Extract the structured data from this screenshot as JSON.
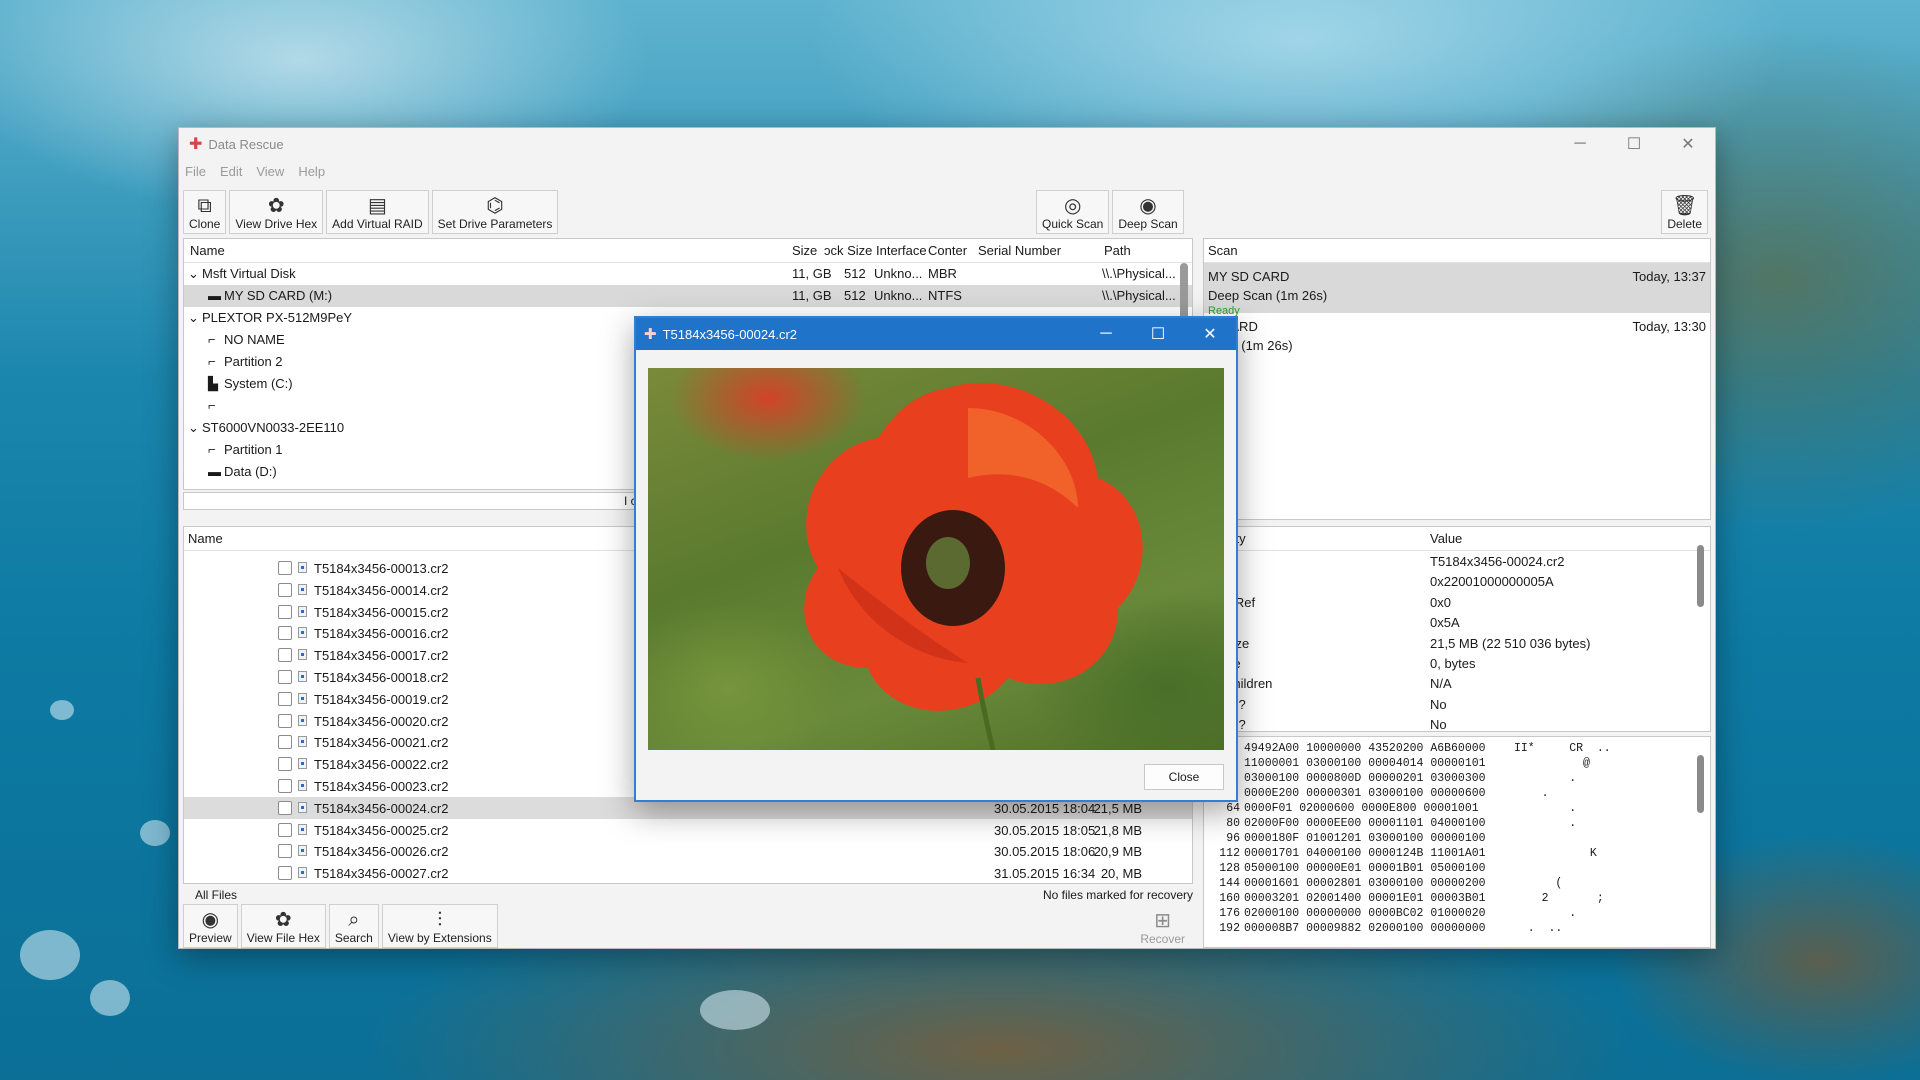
{
  "app": {
    "title": "Data Rescue",
    "menu": [
      "File",
      "Edit",
      "View",
      "Help"
    ],
    "window_controls": {
      "minimize": "─",
      "maximize": "☐",
      "close": "✕"
    }
  },
  "toolbar": {
    "clone": "Clone",
    "view_drive_hex": "View Drive Hex",
    "add_virtual_raid": "Add Virtual RAID",
    "set_drive_parameters": "Set Drive Parameters",
    "quick_scan": "Quick Scan",
    "deep_scan": "Deep Scan",
    "delete": "Delete"
  },
  "drives": {
    "columns": {
      "name": "Name",
      "size": "Size",
      "block_size": "ɔck Size",
      "interface": "Interface",
      "content": "Conter",
      "serial": "Serial Number",
      "path": "Path"
    },
    "rows": [
      {
        "name": "Msft Virtual Disk",
        "size": "",
        "block": "",
        "iface": "",
        "content": "",
        "path": ""
      },
      {
        "name": "MY SD CARD (M:)",
        "size": "11, GB",
        "block": "512",
        "iface": "Unkno...",
        "content": "NTFS",
        "path": "\\\\.\\Physical..."
      },
      {
        "name": "PLEXTOR PX-512M9PeY",
        "size": "",
        "block": "",
        "iface": "",
        "content": "",
        "path": ""
      },
      {
        "name": "NO NAME",
        "size": "",
        "block": "",
        "iface": "",
        "content": "",
        "path": ""
      },
      {
        "name": "Partition 2",
        "size": "",
        "block": "",
        "iface": "",
        "content": "",
        "path": ""
      },
      {
        "name": "System (C:)",
        "size": "",
        "block": "",
        "iface": "",
        "content": "",
        "path": ""
      },
      {
        "name": "",
        "size": "",
        "block": "",
        "iface": "",
        "content": "",
        "path": ""
      },
      {
        "name": "ST6000VN0033-2EE110",
        "size": "",
        "block": "",
        "iface": "",
        "content": "",
        "path": ""
      },
      {
        "name": "Partition 1",
        "size": "",
        "block": "",
        "iface": "",
        "content": "",
        "path": ""
      },
      {
        "name": "Data (D:)",
        "size": "",
        "block": "",
        "iface": "",
        "content": "",
        "path": ""
      }
    ],
    "msft": {
      "size": "11, GB",
      "block": "512",
      "iface": "Unkno...",
      "content": "MBR",
      "path": "\\\\.\\Physical..."
    },
    "scroll_label": "I c"
  },
  "scans": {
    "header": "Scan",
    "items": [
      {
        "name": "MY SD CARD",
        "time": "Today, 13:37",
        "detail": "Deep Scan (1m 26s)",
        "status": "Ready"
      },
      {
        "name": "D CARD",
        "time": "Today, 13:30",
        "detail": "Scan (1m 26s)",
        "status": "y"
      }
    ]
  },
  "files": {
    "header": "Name",
    "rows": [
      {
        "name": "T5184x3456-00013.cr2",
        "date": "",
        "size": ""
      },
      {
        "name": "T5184x3456-00014.cr2",
        "date": "",
        "size": ""
      },
      {
        "name": "T5184x3456-00015.cr2",
        "date": "",
        "size": ""
      },
      {
        "name": "T5184x3456-00016.cr2",
        "date": "",
        "size": ""
      },
      {
        "name": "T5184x3456-00017.cr2",
        "date": "",
        "size": ""
      },
      {
        "name": "T5184x3456-00018.cr2",
        "date": "",
        "size": ""
      },
      {
        "name": "T5184x3456-00019.cr2",
        "date": "",
        "size": ""
      },
      {
        "name": "T5184x3456-00020.cr2",
        "date": "",
        "size": ""
      },
      {
        "name": "T5184x3456-00021.cr2",
        "date": "",
        "size": ""
      },
      {
        "name": "T5184x3456-00022.cr2",
        "date": "",
        "size": ""
      },
      {
        "name": "T5184x3456-00023.cr2",
        "date": "",
        "size": ""
      },
      {
        "name": "T5184x3456-00024.cr2",
        "date": "30.05.2015 18:04",
        "size": "21,5 MB"
      },
      {
        "name": "T5184x3456-00025.cr2",
        "date": "30.05.2015 18:05",
        "size": "21,8 MB"
      },
      {
        "name": "T5184x3456-00026.cr2",
        "date": "30.05.2015 18:06",
        "size": "20,9 MB"
      },
      {
        "name": "T5184x3456-00027.cr2",
        "date": "31.05.2015 16:34",
        "size": "20, MB"
      }
    ],
    "filter_label": "All Files",
    "recovery_status": "No files marked for recovery"
  },
  "bottom_toolbar": {
    "preview": "Preview",
    "view_file_hex": "View File Hex",
    "search": "Search",
    "view_by_extensions": "View by Extensions",
    "recover": "Recover"
  },
  "properties": {
    "col_property": "erty",
    "col_value": "Value",
    "rows": [
      {
        "k": "e",
        "v": "T5184x3456-00024.cr2"
      },
      {
        "k": "f",
        "v": "0x22001000000005A"
      },
      {
        "k": "e Ref",
        "v": "0x0"
      },
      {
        "k": "",
        "v": "0x5A"
      },
      {
        "k": "Size",
        "v": "21,5 MB (22 510 036 bytes)"
      },
      {
        "k": "ize",
        "v": "0, bytes"
      },
      {
        "k": "Children",
        "v": "N/A"
      },
      {
        "k": "en?",
        "v": "No"
      },
      {
        "k": "ed?",
        "v": "No"
      }
    ]
  },
  "hex": {
    "rows": [
      {
        "off": "",
        "hex": "49492A00 10000000 43520200 A6B60000",
        "ascii": "II*     CR  .."
      },
      {
        "off": "",
        "hex": "11000001 03000100 00004014 00000101",
        "ascii": "          @"
      },
      {
        "off": "",
        "hex": "03000100 0000800D 00000201 03000300",
        "ascii": "        ."
      },
      {
        "off": "",
        "hex": "0000E200 00000301 03000100 00000600",
        "ascii": "    ."
      },
      {
        "off": "64",
        "hex": "0000F01 02000600 0000E800 00001001",
        "ascii": "        ."
      },
      {
        "off": "80",
        "hex": "02000F00 0000EE00 00001101 04000100",
        "ascii": "        ."
      },
      {
        "off": "96",
        "hex": "0000180F 01001201 03000100 00000100",
        "ascii": ""
      },
      {
        "off": "112",
        "hex": "00001701 04000100 0000124B 11001A01",
        "ascii": "           K"
      },
      {
        "off": "128",
        "hex": "05000100 00000E01 00001B01 05000100",
        "ascii": ""
      },
      {
        "off": "144",
        "hex": "00001601 00002801 03000100 00000200",
        "ascii": "      ("
      },
      {
        "off": "160",
        "hex": "00003201 02001400 00001E01 00003B01",
        "ascii": "    2       ;"
      },
      {
        "off": "176",
        "hex": "02000100 00000000 0000BC02 01000020",
        "ascii": "        ."
      },
      {
        "off": "192",
        "hex": "000008B7 00009882 02000100 00000000",
        "ascii": "  .  .."
      }
    ]
  },
  "preview_dialog": {
    "title": "T5184x3456-00024.cr2",
    "close_label": "Close"
  }
}
